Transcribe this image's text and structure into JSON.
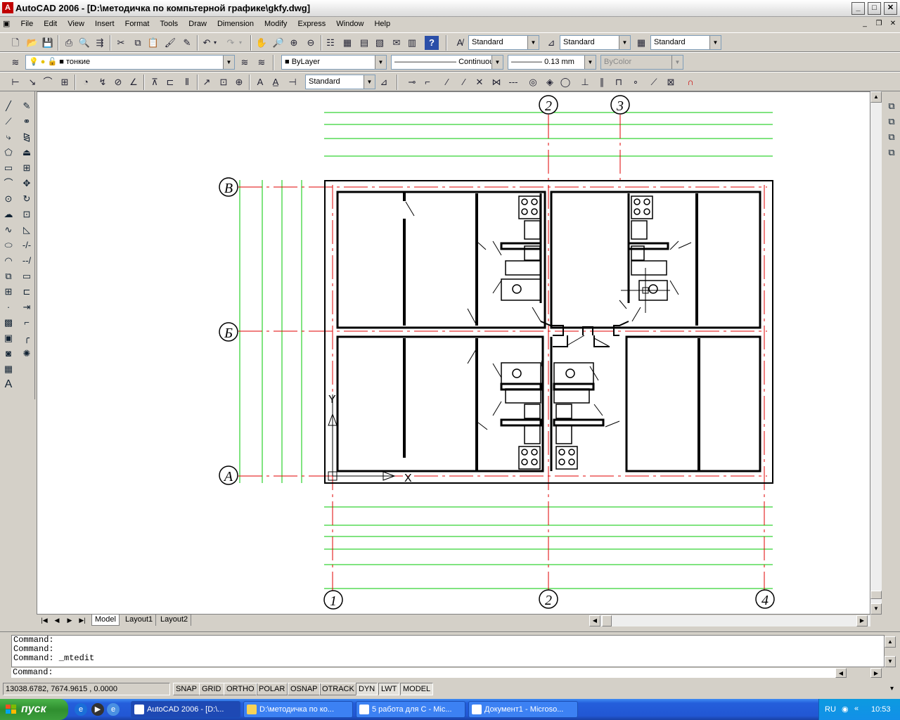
{
  "window": {
    "title": "AutoCAD 2006 - [D:\\методичка по компьтерной графике\\gkfy.dwg]",
    "app_icon": "A"
  },
  "menu": [
    "File",
    "Edit",
    "View",
    "Insert",
    "Format",
    "Tools",
    "Draw",
    "Dimension",
    "Modify",
    "Express",
    "Window",
    "Help"
  ],
  "styles_toolbar": {
    "text_style": "Standard",
    "dim_style": "Standard",
    "table_style": "Standard"
  },
  "layers_toolbar": {
    "layer": "тонкие"
  },
  "properties_toolbar": {
    "color": "ByLayer",
    "linetype": "Continuous",
    "lineweight": "0.13 mm",
    "plotstyle": "ByColor"
  },
  "dimension_toolbar": {
    "dim_style": "Standard"
  },
  "drawing": {
    "grid_letters": [
      "В",
      "Б",
      "А"
    ],
    "grid_numbers_top": [
      "2",
      "3"
    ],
    "grid_numbers_bottom": [
      "1",
      "2",
      "4"
    ],
    "ucs_x": "X",
    "ucs_y": "Y",
    "colors": {
      "axes": "#e00000",
      "dims": "#00c800",
      "walls": "#000000"
    }
  },
  "layout_tabs": [
    "Model",
    "Layout1",
    "Layout2"
  ],
  "command": {
    "history": [
      "Command:",
      "Command:",
      "Command: _mtedit"
    ],
    "prompt": "Command:"
  },
  "status": {
    "coords": "13038.6782, 7674.9615 , 0.0000",
    "toggles": [
      "SNAP",
      "GRID",
      "ORTHO",
      "POLAR",
      "OSNAP",
      "OTRACK",
      "DYN",
      "LWT",
      "MODEL"
    ]
  },
  "taskbar": {
    "start": "пуск",
    "tasks": [
      "AutoCAD 2006 - [D:\\...",
      "D:\\методичка по ко...",
      "5 работа для C - Mic...",
      "Документ1 - Microso..."
    ],
    "lang": "RU",
    "clock": "10:53"
  }
}
